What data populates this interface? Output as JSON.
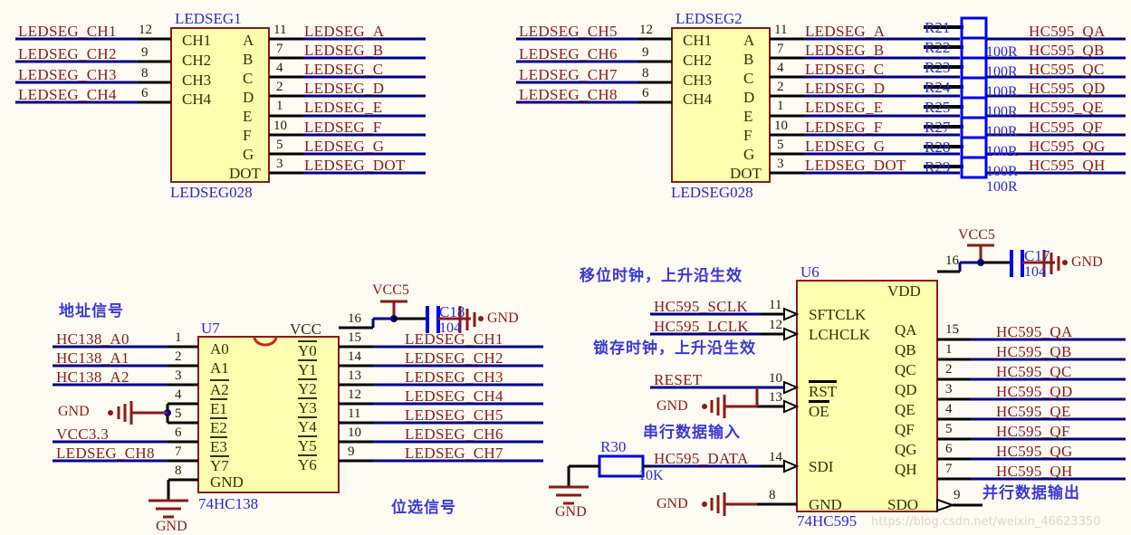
{
  "sheet": {
    "background": "#fdfbf2",
    "watermark": "https://blog.csdn.net/weixin_46623350",
    "colors": {
      "net_label": "#8b1a1a",
      "wire_blue": "#00008b",
      "wire_black": "#000000",
      "body_fill": "#ffffb0",
      "body_stroke": "#8b1a1a",
      "ref_blue": "#2a2ad0",
      "power_red": "#8b1a1a",
      "annotation_blue": "#3a3ad8"
    }
  },
  "ledseg1": {
    "ref": "LEDSEG1",
    "part": "LEDSEG028",
    "left_pins": [
      {
        "num": "12",
        "name": "CH1",
        "net": "LEDSEG_CH1"
      },
      {
        "num": "9",
        "name": "CH2",
        "net": "LEDSEG_CH2"
      },
      {
        "num": "8",
        "name": "CH3",
        "net": "LEDSEG_CH3"
      },
      {
        "num": "6",
        "name": "CH4",
        "net": "LEDSEG_CH4"
      }
    ],
    "right_pins": [
      {
        "num": "11",
        "name": "A",
        "net": "LEDSEG_A"
      },
      {
        "num": "7",
        "name": "B",
        "net": "LEDSEG_B"
      },
      {
        "num": "4",
        "name": "C",
        "net": "LEDSEG_C"
      },
      {
        "num": "2",
        "name": "D",
        "net": "LEDSEG_D"
      },
      {
        "num": "1",
        "name": "E",
        "net": "LEDSEG_E"
      },
      {
        "num": "10",
        "name": "F",
        "net": "LEDSEG_F"
      },
      {
        "num": "5",
        "name": "G",
        "net": "LEDSEG_G"
      },
      {
        "num": "3",
        "name": "DOT",
        "net": "LEDSEG_DOT"
      }
    ]
  },
  "ledseg2": {
    "ref": "LEDSEG2",
    "part": "LEDSEG028",
    "left_pins": [
      {
        "num": "12",
        "name": "CH1",
        "net": "LEDSEG_CH5"
      },
      {
        "num": "9",
        "name": "CH2",
        "net": "LEDSEG_CH6"
      },
      {
        "num": "8",
        "name": "CH3",
        "net": "LEDSEG_CH7"
      },
      {
        "num": "6",
        "name": "CH4",
        "net": "LEDSEG_CH8"
      }
    ],
    "right_pins": [
      {
        "num": "11",
        "name": "A",
        "net": "LEDSEG_A"
      },
      {
        "num": "7",
        "name": "B",
        "net": "LEDSEG_B"
      },
      {
        "num": "4",
        "name": "C",
        "net": "LEDSEG_C"
      },
      {
        "num": "2",
        "name": "D",
        "net": "LEDSEG_D"
      },
      {
        "num": "1",
        "name": "E",
        "net": "LEDSEG_E"
      },
      {
        "num": "10",
        "name": "F",
        "net": "LEDSEG_F"
      },
      {
        "num": "5",
        "name": "G",
        "net": "LEDSEG_G"
      },
      {
        "num": "3",
        "name": "DOT",
        "net": "LEDSEG_DOT"
      }
    ]
  },
  "resistor_network": [
    {
      "ref": "R21",
      "value": "100R",
      "net": "HC595_QA"
    },
    {
      "ref": "R22",
      "value": "100R",
      "net": "HC595_QB"
    },
    {
      "ref": "R23",
      "value": "100R",
      "net": "HC595_QC"
    },
    {
      "ref": "R24",
      "value": "100R",
      "net": "HC595_QD"
    },
    {
      "ref": "R25",
      "value": "100R",
      "net": "HC595_QE"
    },
    {
      "ref": "R27",
      "value": "100R",
      "net": "HC595_QF"
    },
    {
      "ref": "R28",
      "value": "100R",
      "net": "HC595_QG"
    },
    {
      "ref": "R29",
      "value": "100R",
      "net": "HC595_QH"
    }
  ],
  "u7": {
    "ref": "U7",
    "part": "74HC138",
    "annotation_top": "地址信号",
    "annotation_bottom": "位选信号",
    "left_pins": [
      {
        "num": "1",
        "name": "A0",
        "net": "HC138_A0",
        "overline": false
      },
      {
        "num": "2",
        "name": "A1",
        "net": "HC138_A1",
        "overline": false
      },
      {
        "num": "3",
        "name": "A2",
        "net": "HC138_A2",
        "overline": false
      },
      {
        "num": "4",
        "name": "E1",
        "net": "GND",
        "overline": true
      },
      {
        "num": "5",
        "name": "E2",
        "net": "GND",
        "overline": true
      },
      {
        "num": "6",
        "name": "E3",
        "net": "VCC3.3",
        "overline": false
      },
      {
        "num": "7",
        "name": "Y7",
        "net": "LEDSEG_CH8",
        "overline": true
      },
      {
        "num": "8",
        "name": "GND",
        "net": "GND",
        "overline": false
      }
    ],
    "right_pins": [
      {
        "num": "16",
        "name": "VCC",
        "net": "VCC5",
        "overline": false
      },
      {
        "num": "15",
        "name": "Y0",
        "net": "LEDSEG_CH1",
        "overline": true
      },
      {
        "num": "14",
        "name": "Y1",
        "net": "LEDSEG_CH2",
        "overline": true
      },
      {
        "num": "13",
        "name": "Y2",
        "net": "LEDSEG_CH3",
        "overline": true
      },
      {
        "num": "12",
        "name": "Y3",
        "net": "LEDSEG_CH4",
        "overline": true
      },
      {
        "num": "11",
        "name": "Y4",
        "net": "LEDSEG_CH5",
        "overline": true
      },
      {
        "num": "10",
        "name": "Y5",
        "net": "LEDSEG_CH6",
        "overline": true
      },
      {
        "num": "9",
        "name": "Y6",
        "net": "LEDSEG_CH7",
        "overline": true
      }
    ],
    "decoupling": {
      "ref": "C18",
      "value": "104",
      "power": "VCC5",
      "ground": "GND"
    },
    "gnd_label": "GND"
  },
  "u6": {
    "ref": "U6",
    "part": "74HC595",
    "annotations": {
      "shift_clock": "移位时钟，上升沿生效",
      "latch_clock": "锁存时钟，上升沿生效",
      "serial_in": "串行数据输入",
      "parallel_out": "并行数据输出"
    },
    "left_pins": [
      {
        "num": "11",
        "name": "SFTCLK",
        "net": "HC595_SCLK",
        "overline": false
      },
      {
        "num": "12",
        "name": "LCHCLK",
        "net": "HC595_LCLK",
        "overline": false
      },
      {
        "num": "10",
        "name": "RST",
        "net": "RESET",
        "overline": true
      },
      {
        "num": "13",
        "name": "OE",
        "net": "GND",
        "overline": true
      },
      {
        "num": "14",
        "name": "SDI",
        "net": "HC595_DATA",
        "overline": false
      },
      {
        "num": "8",
        "name": "GND",
        "net": "GND",
        "overline": false
      }
    ],
    "right_pins": [
      {
        "num": "16",
        "name": "VDD",
        "net": "VCC5"
      },
      {
        "num": "15",
        "name": "QA",
        "net": "HC595_QA"
      },
      {
        "num": "1",
        "name": "QB",
        "net": "HC595_QB"
      },
      {
        "num": "2",
        "name": "QC",
        "net": "HC595_QC"
      },
      {
        "num": "3",
        "name": "QD",
        "net": "HC595_QD"
      },
      {
        "num": "4",
        "name": "QE",
        "net": "HC595_QE"
      },
      {
        "num": "5",
        "name": "QF",
        "net": "HC595_QF"
      },
      {
        "num": "6",
        "name": "QG",
        "net": "HC595_QG"
      },
      {
        "num": "7",
        "name": "QH",
        "net": "HC595_QH"
      },
      {
        "num": "9",
        "name": "SDO",
        "net": ""
      }
    ],
    "decoupling": {
      "ref": "C17",
      "value": "104",
      "power": "VCC5",
      "ground": "GND"
    },
    "pulldown": {
      "ref": "R30",
      "value": "10K",
      "ground": "GND"
    },
    "gnd_label": "GND"
  },
  "power_labels": {
    "vcc5": "VCC5",
    "vcc33": "VCC3.3",
    "gnd": "GND"
  }
}
